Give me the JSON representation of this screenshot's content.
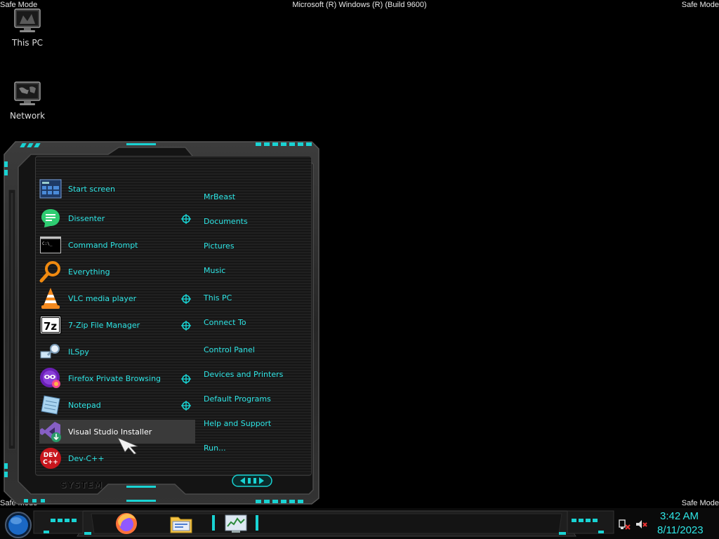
{
  "screen": {
    "safe_mode": "Safe Mode",
    "build": "Microsoft (R) Windows (R) (Build 9600)"
  },
  "desktop": {
    "icons": [
      {
        "label": "This PC",
        "icon": "computer-icon"
      },
      {
        "label": "Network",
        "icon": "network-icon"
      }
    ]
  },
  "start_menu": {
    "programs": [
      {
        "label": "Start screen",
        "icon": "start-screen-icon",
        "jump": false
      },
      {
        "label": "Dissenter",
        "icon": "dissenter-icon",
        "jump": true
      },
      {
        "label": "Command Prompt",
        "icon": "command-prompt-icon",
        "jump": false
      },
      {
        "label": "Everything",
        "icon": "everything-search-icon",
        "jump": false
      },
      {
        "label": "VLC media player",
        "icon": "vlc-icon",
        "jump": true
      },
      {
        "label": "7-Zip File Manager",
        "icon": "7zip-icon",
        "jump": true
      },
      {
        "label": "ILSpy",
        "icon": "ilspy-icon",
        "jump": false
      },
      {
        "label": "Firefox Private Browsing",
        "icon": "firefox-private-icon",
        "jump": true
      },
      {
        "label": "Notepad",
        "icon": "notepad-icon",
        "jump": true
      },
      {
        "label": "Visual Studio Installer",
        "icon": "visual-studio-installer-icon",
        "jump": false,
        "selected": true
      },
      {
        "label": "Dev-C++",
        "icon": "devcpp-icon",
        "jump": false
      }
    ],
    "places": [
      "MrBeast",
      "Documents",
      "Pictures",
      "Music",
      "This PC",
      "Connect To",
      "Control Panel",
      "Devices and Printers",
      "Default Programs",
      "Help and Support",
      "Run..."
    ],
    "footer_label": "SYSTEM"
  },
  "taskbar": {
    "pinned": [
      {
        "icon": "firefox-icon"
      },
      {
        "icon": "file-explorer-icon"
      },
      {
        "icon": "task-manager-icon"
      }
    ],
    "clock_time": "3:42 AM",
    "clock_date": "8/11/2023"
  },
  "colors": {
    "accent": "#2ee6e6",
    "frame": "#2a2a2a",
    "background": "#000000"
  }
}
